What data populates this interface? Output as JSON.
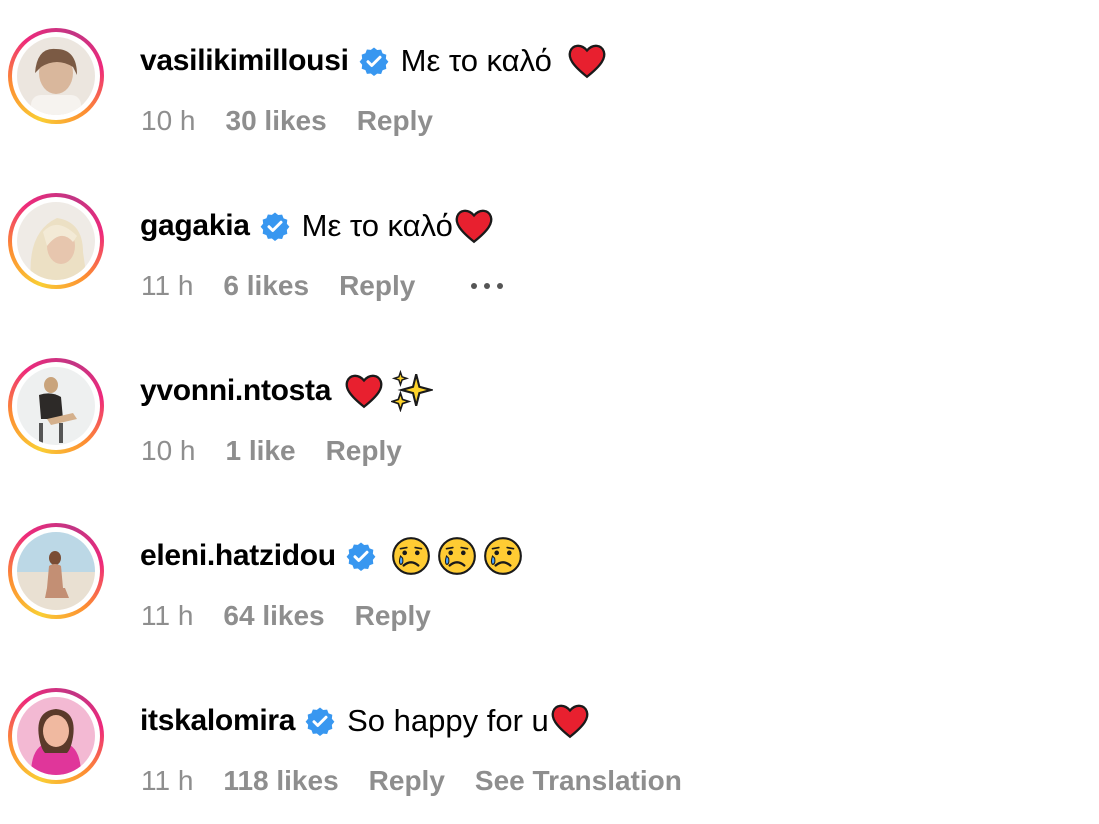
{
  "comments": [
    {
      "username": "vasilikimillousi",
      "verified": true,
      "text": "Με το καλό",
      "emojis": [
        "red-heart"
      ],
      "time": "10 h",
      "likes": "30 likes",
      "reply": "Reply",
      "avatar_colors": [
        "#e8e0d8",
        "#b09a86",
        "#f4efe9"
      ]
    },
    {
      "username": "gagakia",
      "verified": true,
      "text": "Με το καλό",
      "emojis": [
        "red-heart"
      ],
      "time": "11 h",
      "likes": "6 likes",
      "reply": "Reply",
      "show_more": true,
      "avatar_colors": [
        "#f1ede8",
        "#e6d6b8",
        "#d8c8b0"
      ]
    },
    {
      "username": "yvonni.ntosta",
      "verified": false,
      "text": "",
      "emojis": [
        "red-heart",
        "sparkles"
      ],
      "time": "10 h",
      "likes": "1 like",
      "reply": "Reply",
      "avatar_colors": [
        "#eef0f0",
        "#2d2a28",
        "#c9a47c"
      ]
    },
    {
      "username": "eleni.hatzidou",
      "verified": true,
      "text": "",
      "emojis": [
        "crying-face",
        "crying-face",
        "crying-face"
      ],
      "time": "11 h",
      "likes": "64 likes",
      "reply": "Reply",
      "avatar_colors": [
        "#bcd8e6",
        "#e9e0d2",
        "#c38f74"
      ]
    },
    {
      "username": "itskalomira",
      "verified": true,
      "text": "So happy for u",
      "emojis": [
        "red-heart"
      ],
      "time": "11 h",
      "likes": "118 likes",
      "reply": "Reply",
      "translate": "See Translation",
      "avatar_colors": [
        "#e46aa8",
        "#5a3a2a",
        "#f0b9a0"
      ]
    }
  ],
  "colors": {
    "meta_text": "#8e8e8e",
    "verified_blue": "#3897f0",
    "heart_red": "#e8202f"
  }
}
